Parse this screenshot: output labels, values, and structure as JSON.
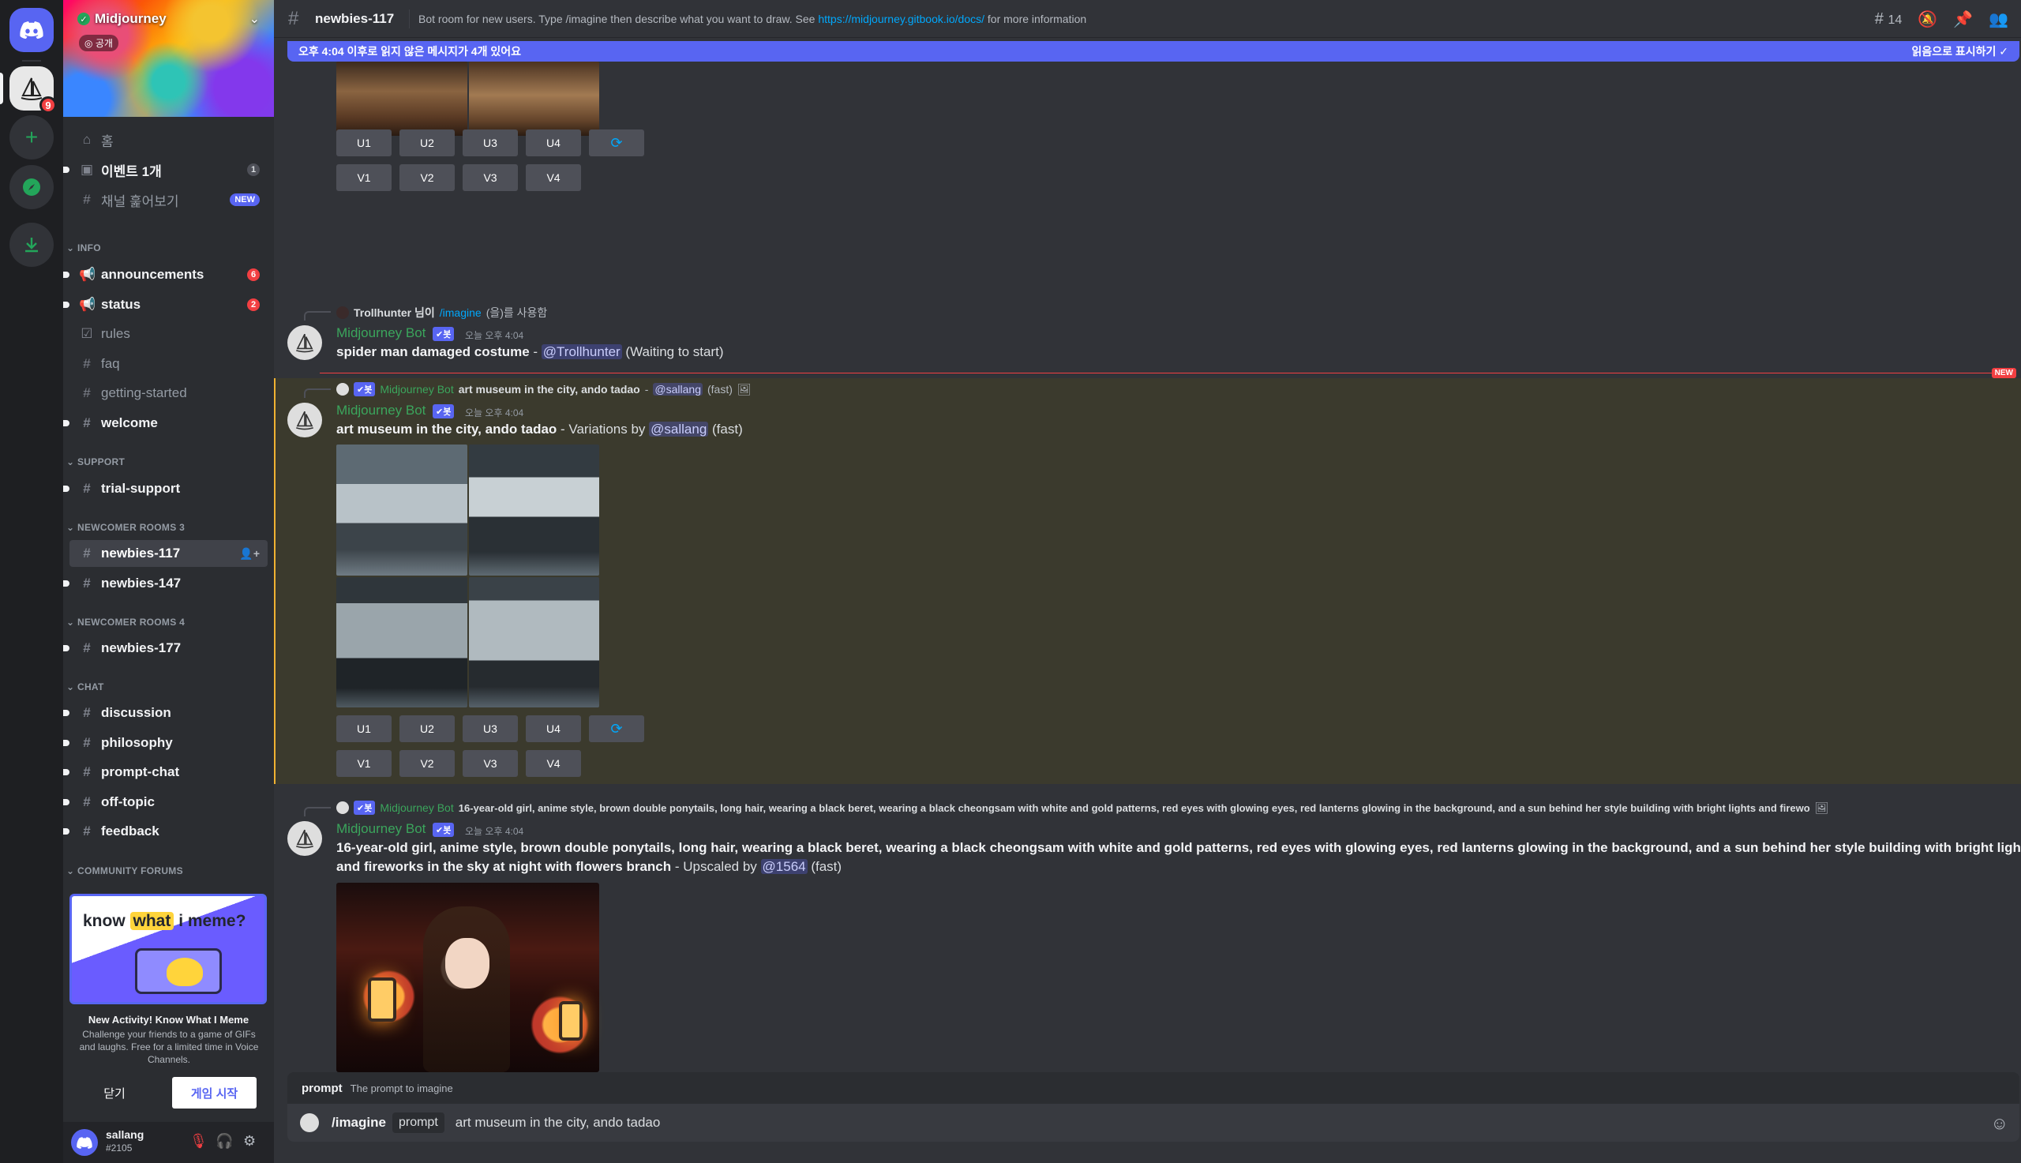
{
  "server": {
    "name": "Midjourney",
    "public_label": "공개",
    "rail_badge": "9"
  },
  "sidebar": {
    "top": [
      {
        "icon": "home-icon",
        "label": "홈"
      },
      {
        "icon": "calendar-icon",
        "label": "이벤트 1개",
        "badge": "1"
      },
      {
        "icon": "browse-channels-icon",
        "label": "채널 훑어보기",
        "badge": "NEW"
      }
    ],
    "categories": {
      "info": "INFO",
      "support": "SUPPORT",
      "newcomer3": "NEWCOMER ROOMS 3",
      "newcomer4": "NEWCOMER ROOMS 4",
      "chat": "CHAT",
      "forums": "COMMUNITY FORUMS"
    },
    "channels": {
      "announcements": {
        "label": "announcements",
        "badge": "6"
      },
      "status": {
        "label": "status",
        "badge": "2"
      },
      "rules": "rules",
      "faq": "faq",
      "getting_started": "getting-started",
      "welcome": "welcome",
      "trial_support": "trial-support",
      "newbies117": "newbies-117",
      "newbies147": "newbies-147",
      "newbies177": "newbies-177",
      "discussion": "discussion",
      "philosophy": "philosophy",
      "prompt_chat": "prompt-chat",
      "off_topic": "off-topic",
      "feedback": "feedback"
    }
  },
  "promo": {
    "title_pre": "know",
    "title_hl": "what",
    "title_post": "i meme?",
    "heading": "New Activity! Know What I Meme",
    "body": "Challenge your friends to a game of GIFs and laughs. Free for a limited time in Voice Channels.",
    "close_label": "닫기",
    "start_label": "게임 시작"
  },
  "user": {
    "name": "sallang",
    "tag": "#2105"
  },
  "header": {
    "channel": "newbies-117",
    "topic_pre": "Bot room for new users. Type /imagine then describe what you want to draw. See ",
    "topic_link": "https://midjourney.gitbook.io/docs/",
    "topic_post": " for more information",
    "thread_count": "14"
  },
  "unread_bar": {
    "text": "오후 4:04 이후로 읽지 않은 메시지가 4개 있어요",
    "action": "읽음으로 표시하기"
  },
  "buttons": {
    "u": [
      "U1",
      "U2",
      "U3",
      "U4"
    ],
    "v": [
      "V1",
      "V2",
      "V3",
      "V4"
    ]
  },
  "messages": {
    "m1": {
      "reply_user": "Trollhunter 님이",
      "reply_cmd": "/imagine",
      "reply_suffix": "(을)를 사용함",
      "author": "Midjourney Bot",
      "bot_tag": "✔봇",
      "time": "오늘 오후 4:04",
      "prompt": "spider man damaged costume",
      "sep": " - ",
      "mention": "@Trollhunter",
      "status": " (Waiting to start)"
    },
    "m2": {
      "reply_author": "Midjourney Bot",
      "reply_prompt": "art museum in the city, ando tadao",
      "reply_mention": "@sallang",
      "reply_mode": "(fast)",
      "author": "Midjourney Bot",
      "bot_tag": "✔봇",
      "time": "오늘 오후 4:04",
      "prompt": "art museum in the city, ando tadao",
      "by": " - Variations by ",
      "mention": "@sallang",
      "mode": " (fast)"
    },
    "m3": {
      "reply_author": "Midjourney Bot",
      "reply_prompt": "16-year-old girl, anime style, brown double ponytails, long hair, wearing a black beret, wearing a black cheongsam with white and gold patterns, red eyes with glowing eyes, red lanterns glowing in the background, and a sun behind her style building with bright lights and firewo",
      "author": "Midjourney Bot",
      "bot_tag": "✔봇",
      "time": "오늘 오후 4:04",
      "prompt_line1": "16-year-old girl, anime style, brown double ponytails, long hair, wearing a black beret, wearing a black cheongsam with white and gold patterns, red eyes with glowing eyes, red lanterns glowing in the background, and a sun behind her style building with bright lights",
      "prompt_line2": "and fireworks in the sky at night with flowers branch",
      "by": " - Upscaled by ",
      "mention": "@1564",
      "mode": " (fast)"
    },
    "new_label": "NEW"
  },
  "composer": {
    "hint_key": "prompt",
    "hint_desc": "The prompt to imagine",
    "command": "/imagine",
    "option": "prompt",
    "value": "art museum in the city, ando tadao"
  }
}
